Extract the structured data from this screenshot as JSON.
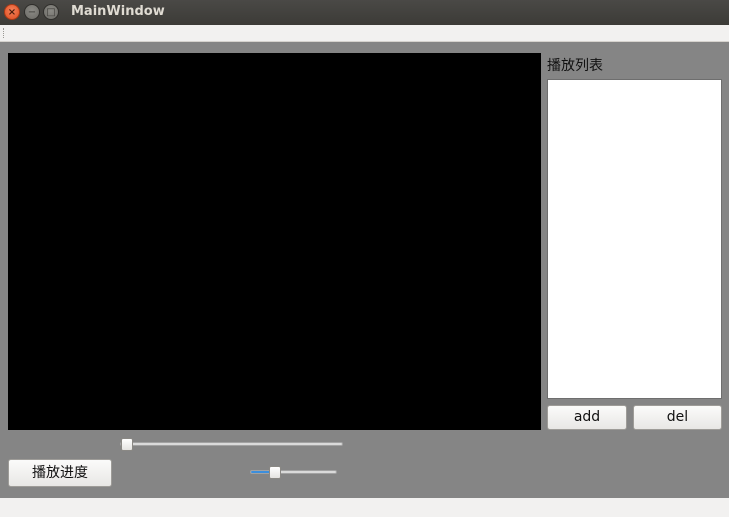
{
  "window": {
    "title": "MainWindow",
    "close_glyph": "×",
    "minimize_glyph": "−",
    "maximize_glyph": "□"
  },
  "playlist": {
    "label": "播放列表",
    "items": []
  },
  "buttons": {
    "add": "add",
    "del": "del",
    "progress": "播放进度"
  },
  "progress_slider": {
    "value_fraction": 0.0
  },
  "volume_slider": {
    "value_fraction": 0.25
  },
  "colors": {
    "background": "#858585",
    "video": "#000000",
    "slider_fill": "#3c8edc"
  }
}
